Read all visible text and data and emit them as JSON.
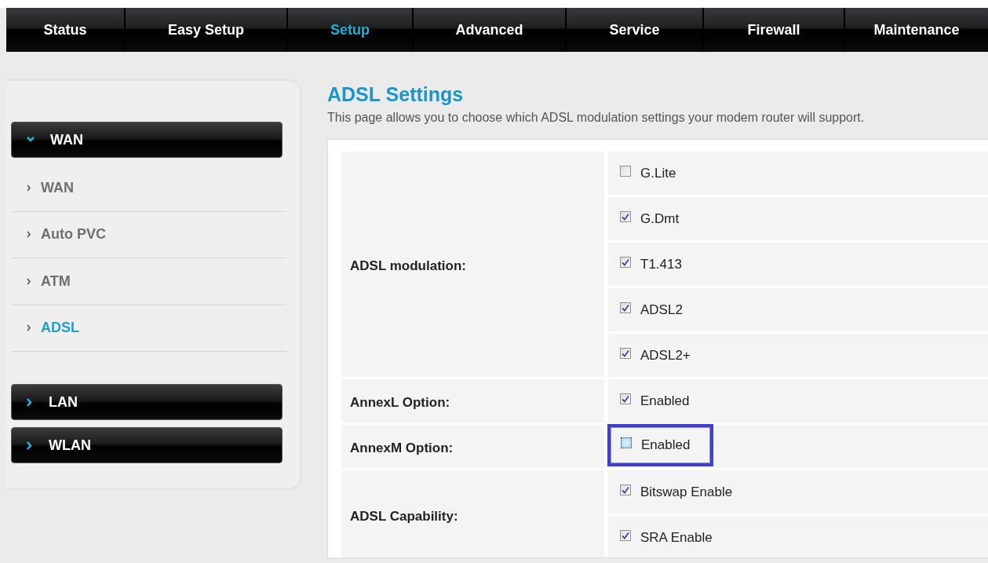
{
  "nav": [
    {
      "label": "Status",
      "selected": false
    },
    {
      "label": "Easy Setup",
      "selected": false
    },
    {
      "label": "Setup",
      "selected": true
    },
    {
      "label": "Advanced",
      "selected": false
    },
    {
      "label": "Service",
      "selected": false
    },
    {
      "label": "Firewall",
      "selected": false
    },
    {
      "label": "Maintenance",
      "selected": false
    }
  ],
  "sidebar": {
    "groups": [
      {
        "label": "WAN",
        "expanded": true,
        "children": [
          {
            "label": "WAN",
            "selected": false
          },
          {
            "label": "Auto PVC",
            "selected": false
          },
          {
            "label": "ATM",
            "selected": false
          },
          {
            "label": "ADSL",
            "selected": true
          }
        ]
      },
      {
        "label": "LAN",
        "expanded": false
      },
      {
        "label": "WLAN",
        "expanded": false
      }
    ]
  },
  "page": {
    "title": "ADSL Settings",
    "description": "This page allows you to choose which ADSL modulation settings your modem router will support."
  },
  "table": {
    "rows": [
      {
        "label": "ADSL modulation:",
        "options": [
          {
            "label": "G.Lite",
            "checked": false,
            "highlighted": false
          },
          {
            "label": "G.Dmt",
            "checked": true,
            "highlighted": false
          },
          {
            "label": "T1.413",
            "checked": true,
            "highlighted": false
          },
          {
            "label": "ADSL2",
            "checked": true,
            "highlighted": false
          },
          {
            "label": "ADSL2+",
            "checked": true,
            "highlighted": false
          }
        ]
      },
      {
        "label": "AnnexL Option:",
        "options": [
          {
            "label": "Enabled",
            "checked": true,
            "highlighted": false
          }
        ]
      },
      {
        "label": "AnnexM Option:",
        "options": [
          {
            "label": "Enabled",
            "checked": false,
            "highlighted": true
          }
        ]
      },
      {
        "label": "ADSL Capability:",
        "options": [
          {
            "label": "Bitswap Enable",
            "checked": true,
            "highlighted": false
          },
          {
            "label": "SRA Enable",
            "checked": true,
            "highlighted": false
          }
        ]
      }
    ]
  }
}
